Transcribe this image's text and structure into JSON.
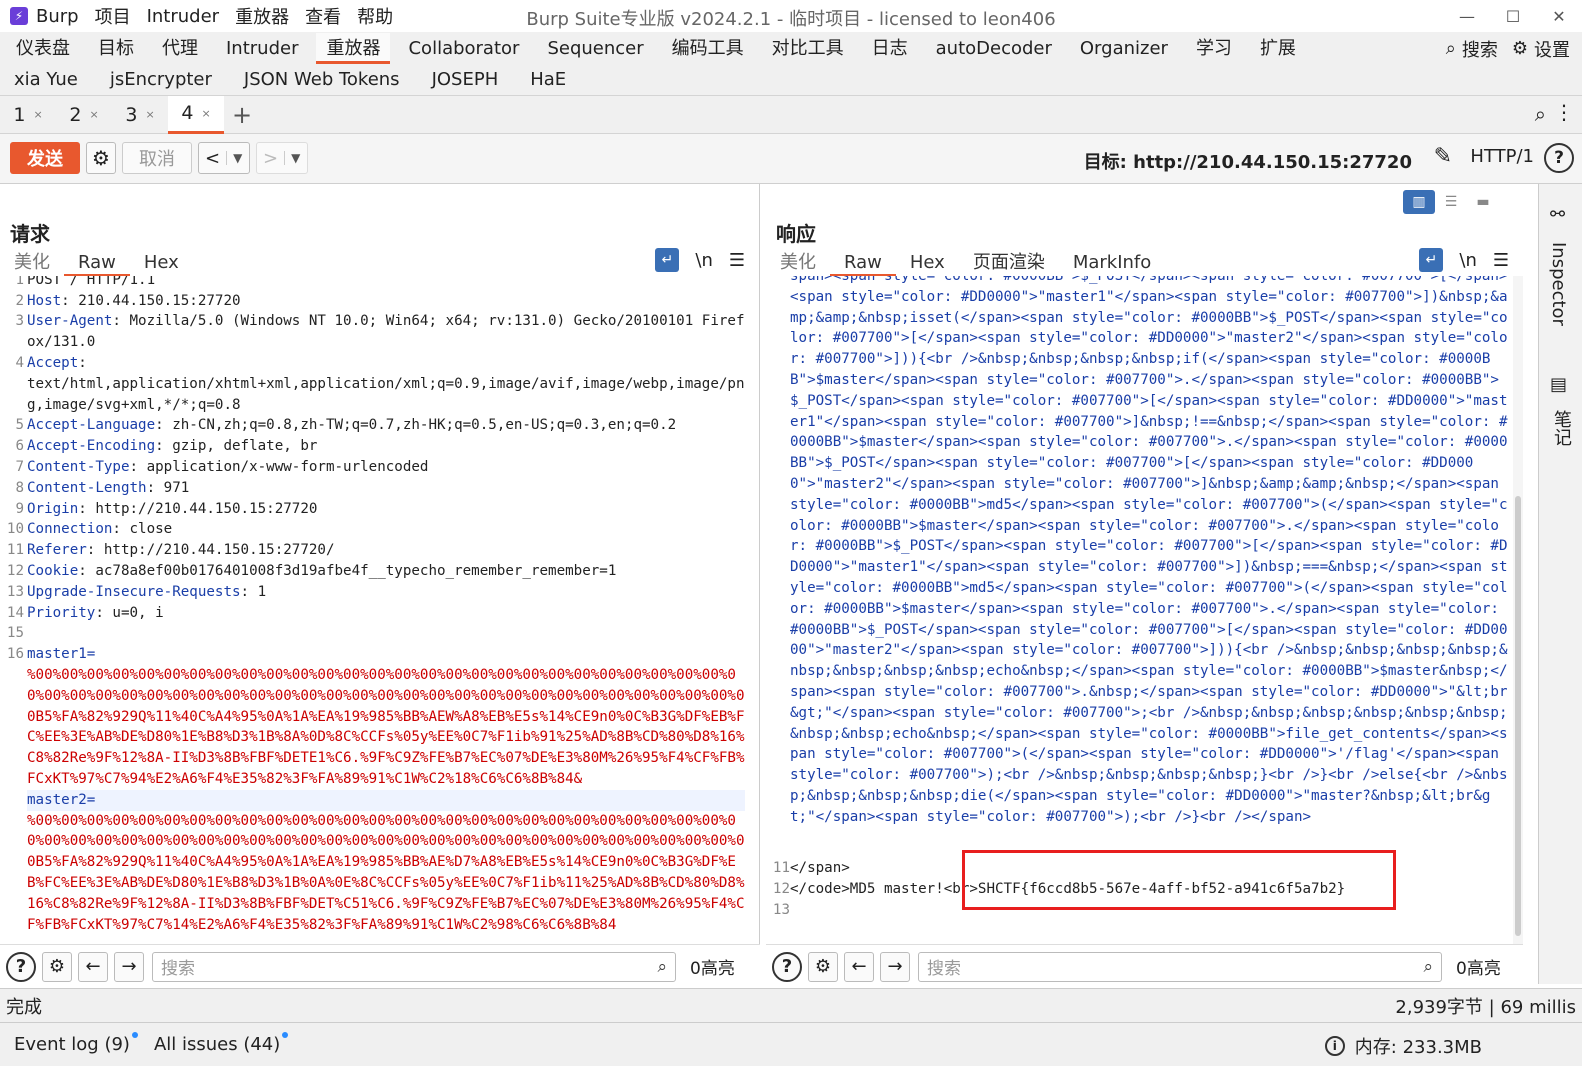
{
  "app": {
    "name": "Burp",
    "title": "Burp Suite专业版  v2024.2.1 - 临时项目 - licensed to leon406"
  },
  "menu": [
    "项目",
    "Intruder",
    "重放器",
    "查看",
    "帮助"
  ],
  "main_tabs_row1": [
    "仪表盘",
    "目标",
    "代理",
    "Intruder",
    "重放器",
    "Collaborator",
    "Sequencer",
    "编码工具",
    "对比工具",
    "日志",
    "autoDecoder",
    "Organizer",
    "学习",
    "扩展"
  ],
  "main_tabs_row2": [
    "xia Yue",
    "jsEncrypter",
    "JSON Web Tokens",
    "JOSEPH",
    "HaE"
  ],
  "active_main_tab": "重放器",
  "search_label": "搜索",
  "settings_label": "设置",
  "sub_tabs": [
    {
      "label": "1",
      "close": "×"
    },
    {
      "label": "2",
      "close": "×"
    },
    {
      "label": "3",
      "close": "×"
    },
    {
      "label": "4",
      "close": "×"
    }
  ],
  "sub_tab_add": "+",
  "toolbar": {
    "send": "发送",
    "cancel": "取消",
    "prev": "<",
    "next": ">",
    "target": "目标: http://210.44.150.15:27720",
    "http_version": "HTTP/1",
    "help": "?"
  },
  "request": {
    "title": "请求",
    "tabs": [
      "美化",
      "Raw",
      "Hex"
    ],
    "lines": [
      {
        "n": "1",
        "k": "",
        "v": "POST / HTTP/1.1"
      },
      {
        "n": "2",
        "k": "Host",
        "v": " 210.44.150.15:27720"
      },
      {
        "n": "3",
        "k": "User-Agent",
        "v": " Mozilla/5.0 (Windows NT 10.0; Win64; x64; rv:131.0) Gecko/20100101 Firefox/131.0"
      },
      {
        "n": "4",
        "k": "Accept",
        "v": "\ntext/html,application/xhtml+xml,application/xml;q=0.9,image/avif,image/webp,image/png,image/svg+xml,*/*;q=0.8"
      },
      {
        "n": "5",
        "k": "Accept-Language",
        "v": " zh-CN,zh;q=0.8,zh-TW;q=0.7,zh-HK;q=0.5,en-US;q=0.3,en;q=0.2"
      },
      {
        "n": "6",
        "k": "Accept-Encoding",
        "v": " gzip, deflate, br"
      },
      {
        "n": "7",
        "k": "Content-Type",
        "v": " application/x-www-form-urlencoded"
      },
      {
        "n": "8",
        "k": "Content-Length",
        "v": " 971"
      },
      {
        "n": "9",
        "k": "Origin",
        "v": " http://210.44.150.15:27720"
      },
      {
        "n": "10",
        "k": "Connection",
        "v": " close"
      },
      {
        "n": "11",
        "k": "Referer",
        "v": " http://210.44.150.15:27720/"
      },
      {
        "n": "12",
        "k": "Cookie",
        "v": " ac78a8ef00b0176401008f3d19afbe4f__typecho_remember_remember=1"
      },
      {
        "n": "13",
        "k": "Upgrade-Insecure-Requests",
        "v": " 1"
      },
      {
        "n": "14",
        "k": "Priority",
        "v": " u=0, i"
      },
      {
        "n": "15",
        "k": "",
        "v": ""
      }
    ],
    "body_line": "16",
    "master1_name": "master1=",
    "master1_value": "%00%00%00%00%00%00%00%00%00%00%00%00%00%00%00%00%00%00%00%00%00%00%00%00%00%00%00%00%00%00%00%00%00%00%00%00%00%00%00%00%00%00%00%00%00%00%00%00%00%00%00%00%00%00%00%00B5%FA%82%929Q%11%40C%A4%95%0A%1A%EA%19%985%BB%AEW%A8%EB%E5s%14%CE9n0%0C%B3G%DF%EB%FC%EE%3E%AB%DE%D80%1E%B8%D3%1B%8A%0D%8C%CCFs%05y%EE%0C7%F1ib%91%25%AD%8B%CD%80%D8%16%C8%82Re%9F%12%8A-II%D3%8B%FBF%DETE1%C6.%9F%C9Z%FE%B7%EC%07%DE%E3%80M%26%95%F4%CF%FB%FCxKT%97%C7%94%E2%A6%F4%E35%82%3F%FA%89%91%C1W%C2%18%C6%C6%8B%84&",
    "master2_name": "master2=",
    "master2_value": "%00%00%00%00%00%00%00%00%00%00%00%00%00%00%00%00%00%00%00%00%00%00%00%00%00%00%00%00%00%00%00%00%00%00%00%00%00%00%00%00%00%00%00%00%00%00%00%00%00%00%00%00%00%00%00%00B5%FA%82%929Q%11%40C%A4%95%0A%1A%EA%19%985%BB%AE%D7%A8%EB%E5s%14%CE9n0%0C%B3G%DF%EB%FC%EE%3E%AB%DE%D80%1E%B8%D3%1B%0A%0E%8C%CCFs%05y%EE%0C7%F1ib%11%25%AD%8B%CD%80%D8%16%C8%82Re%9F%12%8A-II%D3%8B%FBF%DET%C51%C6.%9F%C9Z%FE%B7%EC%07%DE%E3%80M%26%95%F4%CF%FB%FCxKT%97%C7%14%E2%A6%F4%E35%82%3F%FA%89%91%C1W%C2%98%C6%C6%8B%84",
    "search_placeholder": "搜索",
    "highlight": "0高亮"
  },
  "response": {
    "title": "响应",
    "tabs": [
      "美化",
      "Raw",
      "Hex",
      "页面渲染",
      "MarkInfo"
    ],
    "body": "span><span style=\"color: #0000BB\">$_POST</span><span style=\"color: #007700\">[</span><span style=\"color: #DD0000\">\"master1\"</span><span style=\"color: #007700\">])&nbsp;&amp;&amp;&nbsp;isset(</span><span style=\"color: #0000BB\">$_POST</span><span style=\"color: #007700\">[</span><span style=\"color: #DD0000\">\"master2\"</span><span style=\"color: #007700\">])){<br />&nbsp;&nbsp;&nbsp;&nbsp;if(</span><span style=\"color: #0000BB\">$master</span><span style=\"color: #007700\">.</span><span style=\"color: #0000BB\">$_POST</span><span style=\"color: #007700\">[</span><span style=\"color: #DD0000\">\"master1\"</span><span style=\"color: #007700\">]&nbsp;!==&nbsp;</span><span style=\"color: #0000BB\">$master</span><span style=\"color: #007700\">.</span><span style=\"color: #0000BB\">$_POST</span><span style=\"color: #007700\">[</span><span style=\"color: #DD0000\">\"master2\"</span><span style=\"color: #007700\">]&nbsp;&amp;&amp;&nbsp;</span><span style=\"color: #0000BB\">md5</span><span style=\"color: #007700\">(</span><span style=\"color: #0000BB\">$master</span><span style=\"color: #007700\">.</span><span style=\"color: #0000BB\">$_POST</span><span style=\"color: #007700\">[</span><span style=\"color: #DD0000\">\"master1\"</span><span style=\"color: #007700\">])&nbsp;===&nbsp;</span><span style=\"color: #0000BB\">md5</span><span style=\"color: #007700\">(</span><span style=\"color: #0000BB\">$master</span><span style=\"color: #007700\">.</span><span style=\"color: #0000BB\">$_POST</span><span style=\"color: #007700\">[</span><span style=\"color: #DD0000\">\"master2\"</span><span style=\"color: #007700\">])){<br />&nbsp;&nbsp;&nbsp;&nbsp;&nbsp;&nbsp;&nbsp;&nbsp;echo&nbsp;</span><span style=\"color: #0000BB\">$master&nbsp;</span><span style=\"color: #007700\">.&nbsp;</span><span style=\"color: #DD0000\">\"&lt;br&gt;\"</span><span style=\"color: #007700\">;<br />&nbsp;&nbsp;&nbsp;&nbsp;&nbsp;&nbsp;&nbsp;&nbsp;echo&nbsp;</span><span style=\"color: #0000BB\">file_get_contents</span><span style=\"color: #007700\">(</span><span style=\"color: #DD0000\">'/flag'</span><span style=\"color: #007700\">);<br />&nbsp;&nbsp;&nbsp;&nbsp;}<br />}<br />else{<br />&nbsp;&nbsp;&nbsp;&nbsp;die(</span><span style=\"color: #DD0000\">\"master?&nbsp;&lt;br&gt;\"</span><span style=\"color: #007700\">);<br />}<br /></span>",
    "line11": "</span>",
    "line12_pre": "</code>MD5 master!<br>",
    "line12_flag": "SHCTF{f6ccd8b5-567e-4aff-bf52-a941c6f5a7b2}",
    "ln11": "11",
    "ln12": "12",
    "ln13": "13",
    "search_placeholder": "搜索",
    "highlight": "0高亮"
  },
  "inspector": {
    "label": "Inspector",
    "notes": "笔记"
  },
  "status": {
    "left": "完成",
    "right": "2,939字节 | 69 millis"
  },
  "footer": {
    "event_log": "Event log (9)",
    "all_issues": "All issues (44)",
    "memory": "内存: 233.3MB"
  }
}
